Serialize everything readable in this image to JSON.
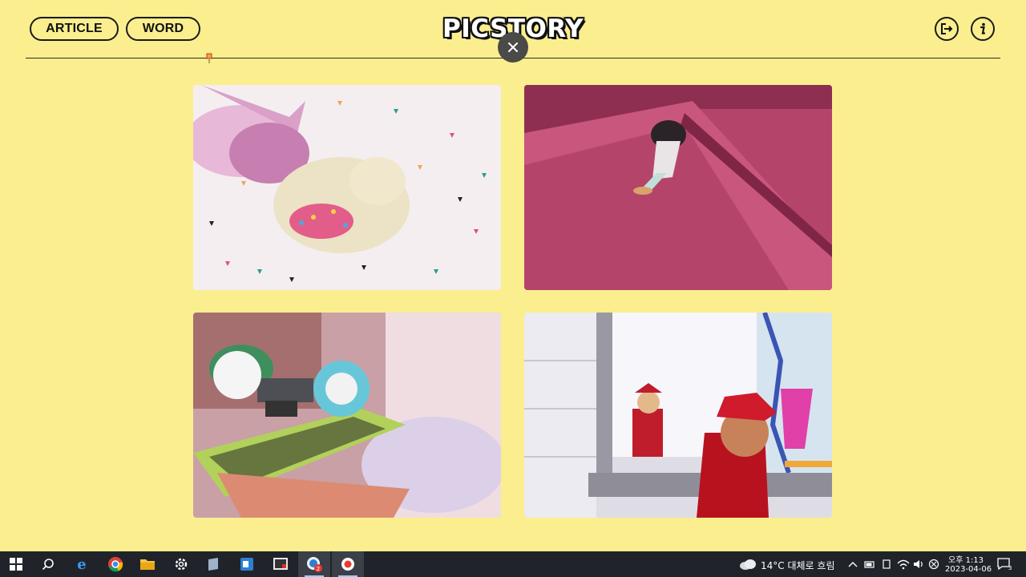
{
  "header": {
    "article_label": "ARTICLE",
    "word_label": "WORD",
    "logo": "PICSTORY"
  },
  "icons": {
    "close": "close-icon",
    "logout": "logout-icon",
    "info": "info-icon"
  },
  "gallery": {
    "items": [
      {
        "subject": "cat-with-pink-paint-and-confetti"
      },
      {
        "subject": "person-sliding-on-pink-ramp"
      },
      {
        "subject": "skateboard-wheels-colorful"
      },
      {
        "subject": "red-hat-figures-in-mirror"
      }
    ]
  },
  "taskbar": {
    "weather": "14°C  대체로 흐림",
    "time_label": "오후 1:13",
    "date": "2023-04-06",
    "notification_count": "3",
    "badge_count": "2"
  },
  "colors": {
    "background": "#fbee8e",
    "accent_dark": "#1a1a1a"
  }
}
